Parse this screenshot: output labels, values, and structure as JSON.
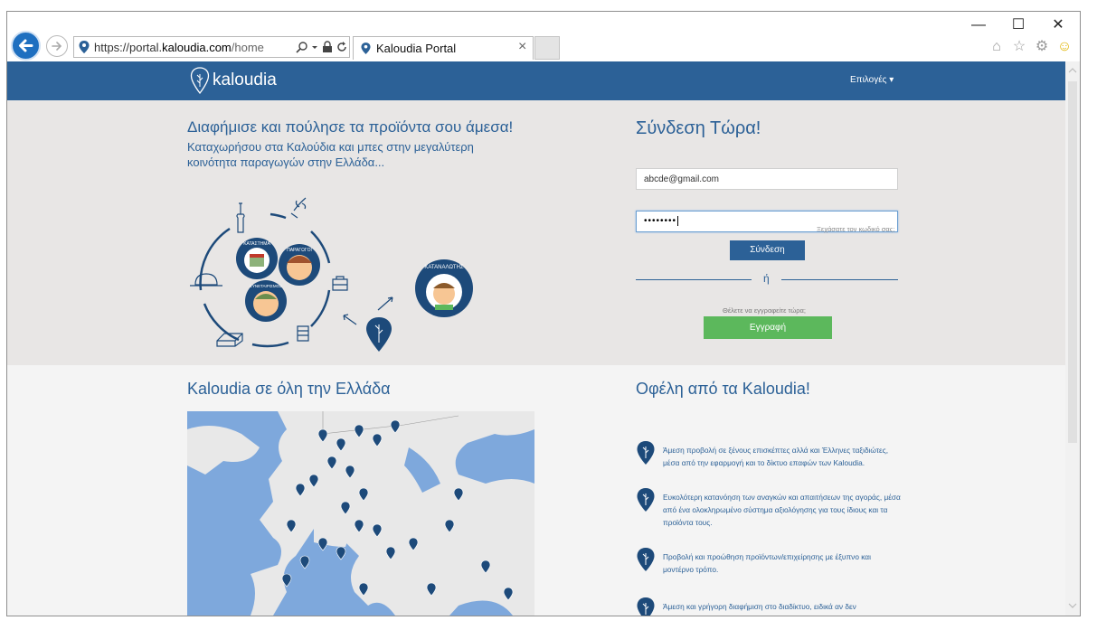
{
  "window": {
    "minimize": "—",
    "maximize": "☐",
    "close": "✕"
  },
  "address_bar": {
    "url_prefix": "https://portal.",
    "url_domain": "kaloudia.com",
    "url_path": "/home"
  },
  "tab": {
    "title": "Kaloudia Portal",
    "close": "×"
  },
  "navbar": {
    "brand": "kaloudia",
    "options_label": "Επιλογές"
  },
  "hero": {
    "title": "Διαφήμισε και πούλησε τα προϊόντα σου άμεσα!",
    "subtitle": "Καταχωρήσου στα Καλούδια και μπες στην μεγαλύτερη κοινότητα παραγωγών στην Ελλάδα...",
    "badges": {
      "shops": "ΚΑΤΑΣΤΗΜΑ",
      "producers": "ΠΑΡΑΓΩΓΟΙ",
      "coops": "ΣΥΝΕΤΑΙΡΙΣΜΟΣ",
      "consumers": "ΚΑΤΑΝΑΛΩΤΗΣ"
    }
  },
  "login": {
    "title": "Σύνδεση Τώρα!",
    "email_value": "abcde@gmail.com",
    "password_value": "••••••••",
    "forgot_label": "Ξεχάσατε τον κωδικό σας;",
    "login_button": "Σύνδεση",
    "or_label": "ή",
    "register_prompt": "Θέλετε να εγγραφείτε τώρα;",
    "register_button": "Εγγραφή"
  },
  "map_section": {
    "title": "Kaloudia σε όλη την Ελλάδα"
  },
  "benefits_section": {
    "title": "Οφέλη από τα Kaloudia!",
    "items": [
      "Άμεση προβολή σε ξένους επισκέπτες αλλά και Έλληνες ταξιδιώτες, μέσα από την εφαρμογή και το δίκτυο επαφών των Kaloudia.",
      "Ευκολότερη κατανόηση των αναγκών και απαιτήσεων της αγοράς, μέσα από ένα ολοκληρωμένο σύστημα αξιολόγησης για τους ίδιους και τα προϊόντα τους.",
      "Προβολή και προώθηση προϊόντων/επιχείρησης με έξυπνο και μοντέρνο τρόπο.",
      "Άμεση και γρήγορη διαφήμιση στο διαδίκτυο, ειδικά αν δεν"
    ]
  },
  "colors": {
    "brand_blue": "#2c6197",
    "register_green": "#5cb85c",
    "hero_bg": "#e8e6e5",
    "map_water": "#7ea8dc"
  }
}
